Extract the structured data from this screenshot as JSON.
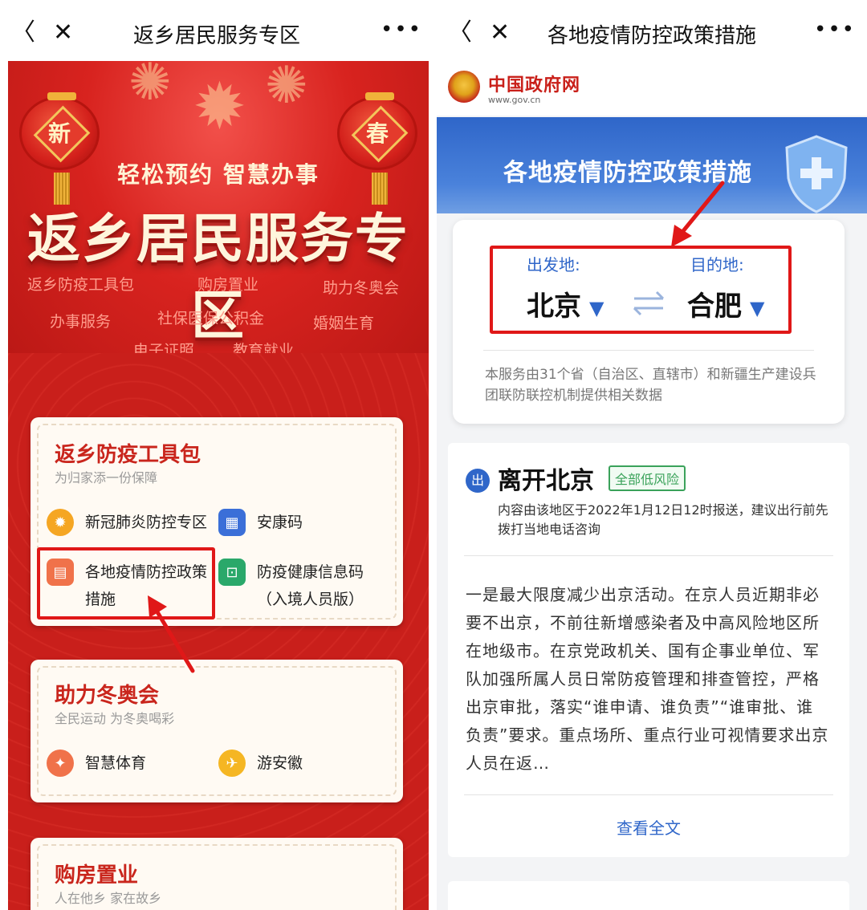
{
  "left": {
    "nav": {
      "title": "返乡居民服务专区",
      "back": "〈",
      "close": "✕",
      "more": "•••"
    },
    "banner": {
      "lantern_left": "新",
      "lantern_right": "春",
      "slogan": "轻松预约 智慧办事",
      "title": "返乡居民服务专区",
      "categories": [
        "返乡防疫工具包",
        "购房置业",
        "助力冬奥会",
        "办事服务",
        "社保医保公积金",
        "婚姻生育",
        "电子证照",
        "教育就业"
      ]
    },
    "cards": [
      {
        "title": "返乡防疫工具包",
        "subtitle": "为归家添一份保障",
        "tools": [
          {
            "label": "新冠肺炎防控专区",
            "icon": "gear-icon",
            "color": "#f5a623"
          },
          {
            "label": "安康码",
            "icon": "qr-code-icon",
            "color": "#3b6fd8"
          },
          {
            "label": "各地疫情防控政策",
            "label2": "措施",
            "icon": "document-badge-icon",
            "color": "#f0724a"
          },
          {
            "label": "防疫健康信息码",
            "label2": "（入境人员版）",
            "icon": "scan-icon",
            "color": "#2aa86a"
          }
        ]
      },
      {
        "title": "助力冬奥会",
        "subtitle": "全民运动 为冬奥喝彩",
        "tools": [
          {
            "label": "智慧体育",
            "icon": "runner-icon",
            "color": "#f0724a"
          },
          {
            "label": "游安徽",
            "icon": "plane-icon",
            "color": "#f5b623"
          }
        ]
      },
      {
        "title": "购房置业",
        "subtitle": "人在他乡 家在故乡"
      }
    ]
  },
  "right": {
    "nav": {
      "title": "各地疫情防控政策措施",
      "back": "〈",
      "close": "✕",
      "more": "•••"
    },
    "gov": {
      "name": "中国政府网",
      "url": "www.gov.cn"
    },
    "hero_title": "各地疫情防控政策措施",
    "route": {
      "from_label": "出发地:",
      "from_city": "北京",
      "to_label": "目的地:",
      "to_city": "合肥",
      "dropdown_glyph": "▼",
      "note": "本服务由31个省（自治区、直辖市）和新疆生产建设兵团联防联控机制提供相关数据"
    },
    "info": {
      "badge": "出",
      "title": "离开北京",
      "risk": "全部低风险",
      "report": "内容由该地区于2022年1月12日12时报送，建议出行前先拨打当地电话咨询",
      "body": "一是最大限度减少出京活动。在京人员近期非必要不出京，不前往新增感染者及中高风险地区所在地级市。在京党政机关、国有企事业单位、军队加强所属人员日常防疫管理和排查管控，严格出京审批，落实“谁申请、谁负责”“谁审批、谁负责”要求。重点场所、重点行业可视情要求出京人员在返…",
      "view_all": "查看全文"
    }
  },
  "colors": {
    "highlight_red": "#e01818",
    "gov_blue": "#2f66c9",
    "banner_red": "#d8231f"
  }
}
